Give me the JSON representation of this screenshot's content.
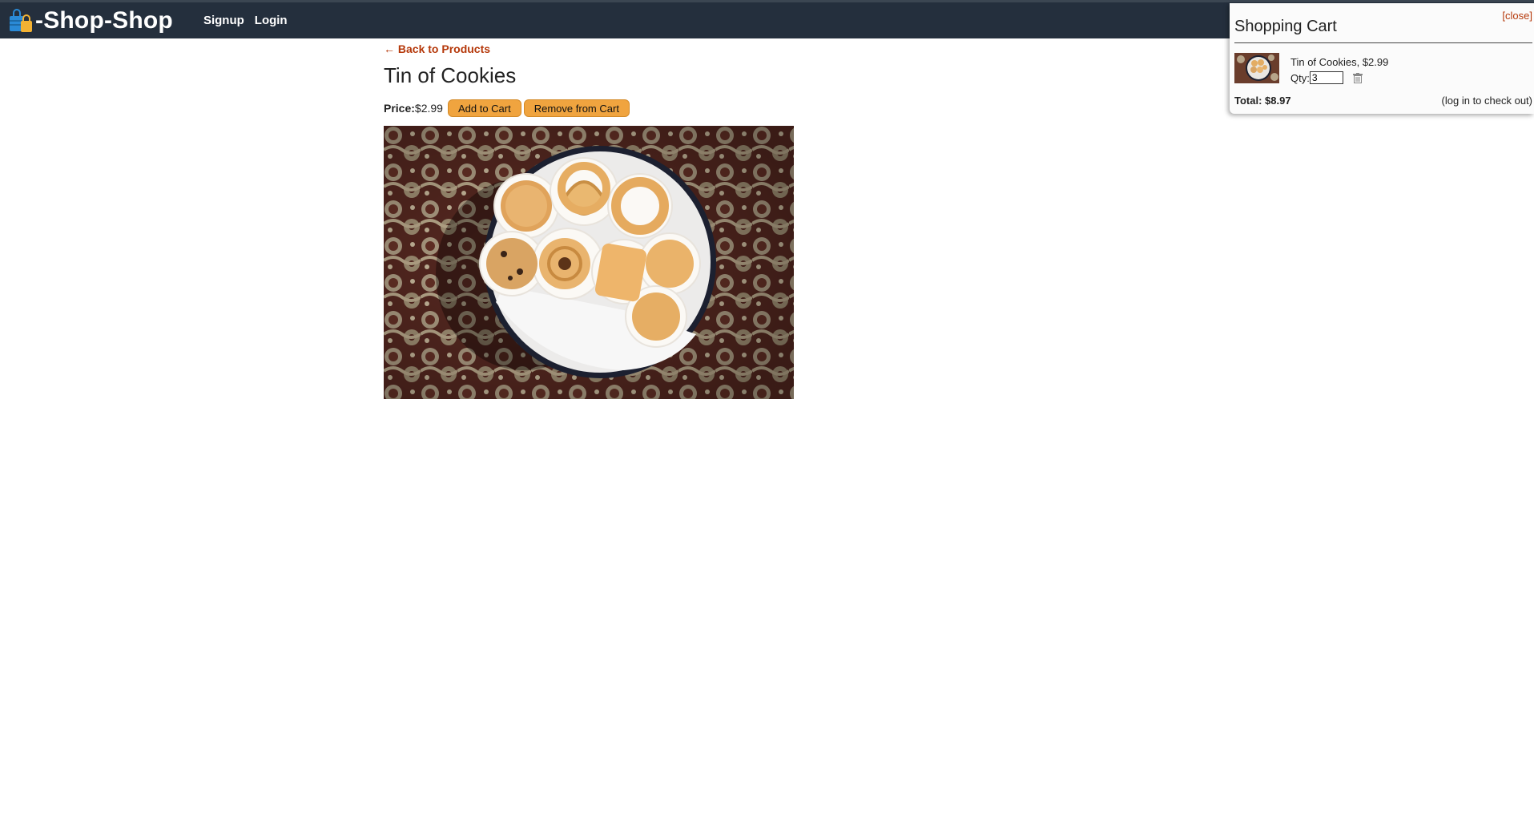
{
  "nav": {
    "brand": "-Shop-Shop",
    "links": [
      "Signup",
      "Login"
    ]
  },
  "product": {
    "back_link": "← Back to Products",
    "name": "Tin of Cookies",
    "price_label": "Price:",
    "price": "$2.99",
    "add_button": "Add to Cart",
    "remove_button": "Remove from Cart"
  },
  "cart": {
    "close": "[close]",
    "title": "Shopping Cart",
    "items": [
      {
        "name": "Tin of Cookies, $2.99",
        "qty_label": "Qty:",
        "qty": "3"
      }
    ],
    "total": "Total: $8.97",
    "checkout_note": "(log in to check out)"
  },
  "colors": {
    "navbar": "#242f3d",
    "accent_button": "#f0a43f",
    "link": "#b5380a"
  },
  "icons": [
    "shopping-bags-icon",
    "trash-icon"
  ]
}
